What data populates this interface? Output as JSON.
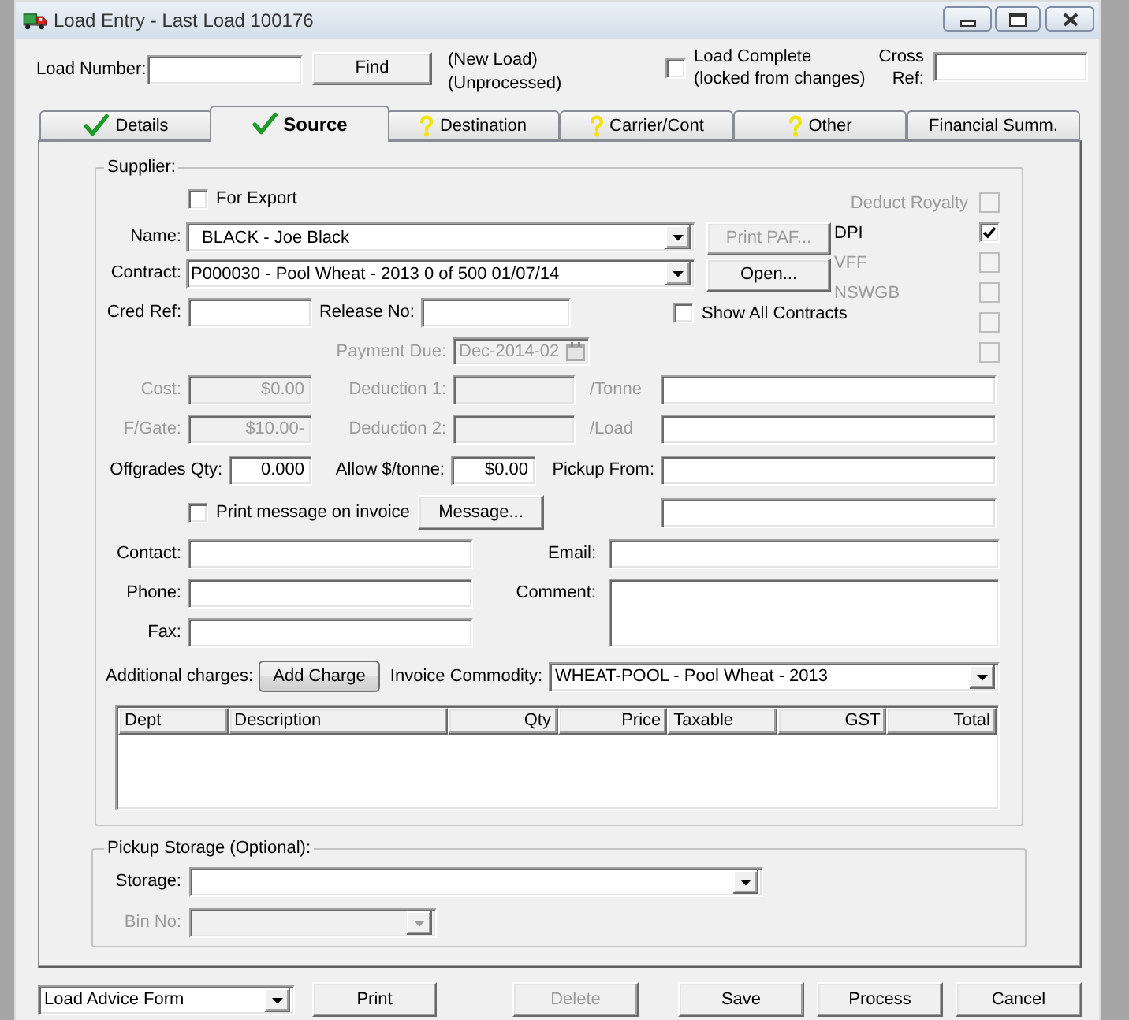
{
  "window": {
    "title": "Load Entry - Last Load 100176"
  },
  "header": {
    "load_number": {
      "label": "Load Number:"
    },
    "find_button": {
      "label": "Find"
    },
    "status": [
      "(New Load)",
      "(Unprocessed)"
    ],
    "load_complete": {
      "label_lines": [
        "Load Complete",
        "(locked from changes)"
      ],
      "checked": false
    },
    "cross_ref": {
      "label_lines": [
        "Cross",
        "Ref:"
      ]
    }
  },
  "tabs": [
    {
      "label": "Details",
      "kind": "complete",
      "selected": false
    },
    {
      "label": "Source",
      "kind": "complete",
      "selected": true
    },
    {
      "label": "Destination",
      "kind": "incomplete",
      "selected": false
    },
    {
      "label": "Carrier/Cont",
      "kind": "incomplete",
      "selected": false
    },
    {
      "label": "Other",
      "kind": "incomplete",
      "selected": false
    },
    {
      "label": "Financial Summ.",
      "kind": "plain",
      "selected": false
    }
  ],
  "supplier": {
    "title": "Supplier:",
    "for_export": {
      "label": "For Export",
      "checked": false
    },
    "name": {
      "label": "Name:",
      "value": "BLACK - Joe Black"
    },
    "print_paf_button": {
      "label": "Print PAF...",
      "disabled": true
    },
    "contract": {
      "label": "Contract:",
      "value": "P000030 - Pool Wheat - 2013 0 of 500 01/07/14"
    },
    "open_button": {
      "label": "Open...",
      "disabled": false
    },
    "cred_ref": {
      "label": "Cred Ref:"
    },
    "release_no": {
      "label": "Release No:"
    },
    "show_all_contracts": {
      "label": "Show All Contracts",
      "checked": false
    },
    "payment_due": {
      "label": "Payment Due:",
      "value": "Dec-2014-02",
      "disabled": true
    },
    "flags": [
      {
        "kind": "inline",
        "label": "Deduct Royalty",
        "checked": false,
        "disabled": true
      },
      {
        "kind": "column",
        "label": "DPI",
        "checked": true,
        "disabled": false
      },
      {
        "kind": "column",
        "label": "VFF",
        "checked": false,
        "disabled": true
      },
      {
        "kind": "column",
        "label": "NSWGB",
        "checked": false,
        "disabled": true
      },
      {
        "kind": "column",
        "checked": false,
        "disabled": true
      },
      {
        "kind": "column",
        "checked": false,
        "disabled": true
      }
    ],
    "cost_rows": [
      {
        "label": "Cost:",
        "value": "$0.00",
        "disabled": true,
        "deduction": {
          "label": "Deduction 1:",
          "disabled": true
        },
        "basis": {
          "label": "/Tonne",
          "disabled": true
        }
      },
      {
        "label": "F/Gate:",
        "value": "$10.00-",
        "disabled": true,
        "deduction": {
          "label": "Deduction 2:",
          "disabled": true
        },
        "basis": {
          "label": "/Load",
          "disabled": true
        }
      }
    ],
    "offgrades_qty": {
      "label": "Offgrades Qty:",
      "value": "0.000"
    },
    "allow_per_tonne": {
      "label": "Allow $/tonne:",
      "value": "$0.00"
    },
    "pickup_from": {
      "label": "Pickup From:"
    },
    "print_message": {
      "label": "Print message on invoice",
      "checked": false
    },
    "message_button": {
      "label": "Message..."
    },
    "contact": {
      "label": "Contact:"
    },
    "email": {
      "label": "Email:"
    },
    "phone": {
      "label": "Phone:"
    },
    "comment": {
      "label": "Comment:"
    },
    "fax": {
      "label": "Fax:"
    },
    "additional_charges": {
      "label": "Additional charges:",
      "button": "Add Charge"
    },
    "invoice_commodity": {
      "label": "Invoice Commodity:",
      "value": "WHEAT-POOL - Pool Wheat - 2013"
    },
    "charges_table": {
      "columns": [
        {
          "label": "Dept",
          "kind": "text"
        },
        {
          "label": "Description",
          "kind": "text"
        },
        {
          "label": "Qty",
          "kind": "number"
        },
        {
          "label": "Price",
          "kind": "number"
        },
        {
          "label": "Taxable",
          "kind": "text"
        },
        {
          "label": "GST",
          "kind": "number"
        },
        {
          "label": "Total",
          "kind": "number"
        }
      ]
    }
  },
  "pickup_storage": {
    "title": "Pickup Storage (Optional):",
    "storage": {
      "label": "Storage:"
    },
    "bin_no": {
      "label": "Bin No:",
      "disabled": true
    }
  },
  "footer": {
    "report": {
      "value": "Load Advice Form"
    },
    "buttons": [
      {
        "label": "Print",
        "disabled": false
      },
      {
        "label": "Delete",
        "disabled": true
      },
      {
        "label": "Save",
        "disabled": false
      },
      {
        "label": "Process",
        "disabled": false
      },
      {
        "label": "Cancel",
        "disabled": false
      }
    ]
  }
}
